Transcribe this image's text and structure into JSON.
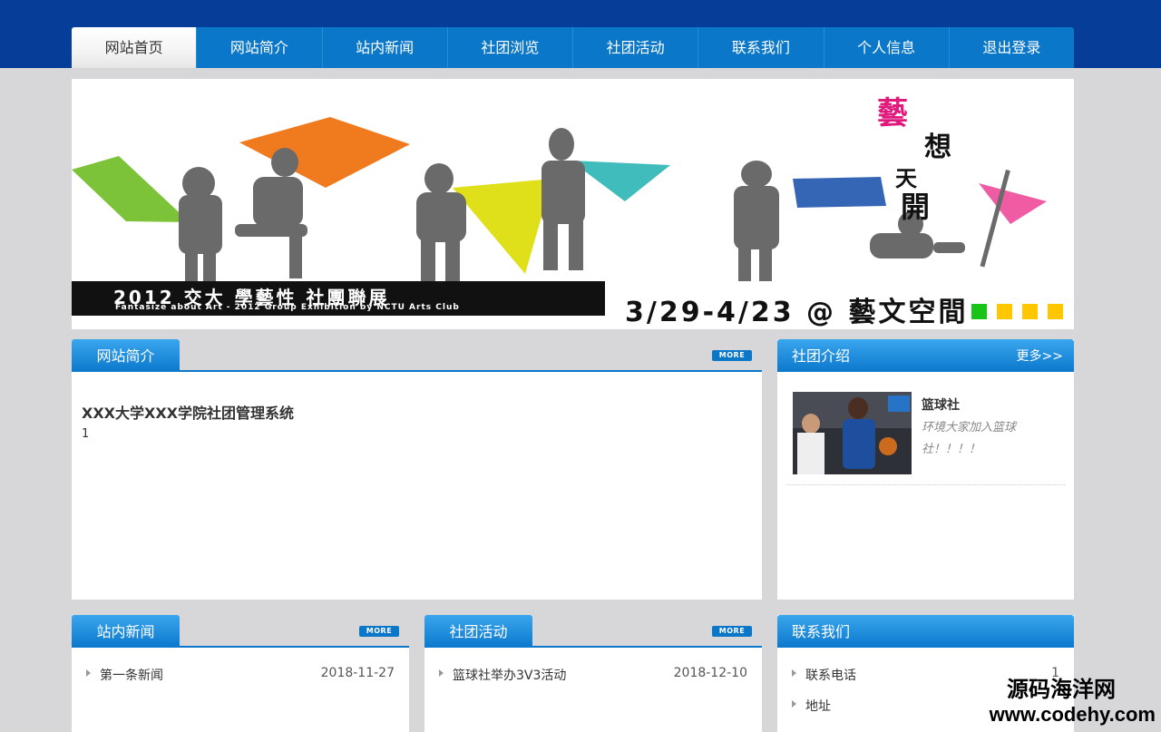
{
  "nav": {
    "items": [
      {
        "label": "网站首页"
      },
      {
        "label": "网站简介"
      },
      {
        "label": "站内新闻"
      },
      {
        "label": "社团浏览"
      },
      {
        "label": "社团活动"
      },
      {
        "label": "联系我们"
      },
      {
        "label": "个人信息"
      },
      {
        "label": "退出登录"
      }
    ]
  },
  "banner": {
    "event_title": "2012 交大 學藝性 社團聯展",
    "event_subtitle": "Fantasize about Art - 2012 Group Exhibition by NCTU Arts Club",
    "dates": "3/29-4/23 @ 藝文空間",
    "vertical_title": [
      "藝",
      "想",
      "天",
      "開"
    ]
  },
  "intro_panel": {
    "tab": "网站简介",
    "more": "MORE",
    "title": "XXX大学XXX学院社团管理系统",
    "text": "1"
  },
  "club_panel": {
    "tab": "社团介绍",
    "more": "更多>>",
    "club_name": "篮球社",
    "club_desc": "环境大家加入篮球",
    "club_desc2": "社！！！！"
  },
  "news_panel": {
    "tab": "站内新闻",
    "more": "MORE",
    "items": [
      {
        "label": "第一条新闻",
        "date": "2018-11-27"
      }
    ]
  },
  "activity_panel": {
    "tab": "社团活动",
    "more": "MORE",
    "items": [
      {
        "label": "篮球社举办3V3活动",
        "date": "2018-12-10"
      }
    ]
  },
  "contact_panel": {
    "tab": "联系我们",
    "items": [
      {
        "label": "联系电话",
        "value": "1"
      },
      {
        "label": "地址",
        "value": ""
      }
    ]
  },
  "watermark": {
    "line1": "源码海洋网",
    "line2": "www.codehy.com"
  }
}
